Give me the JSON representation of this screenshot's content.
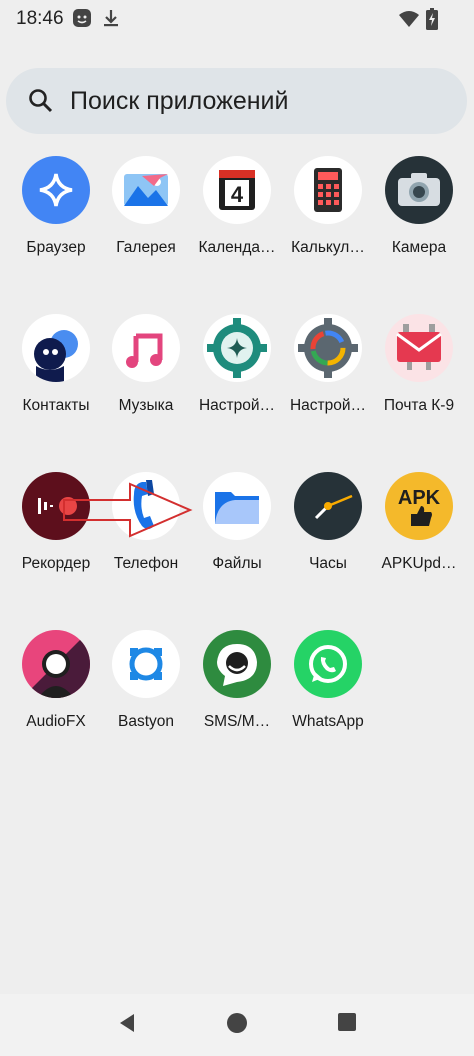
{
  "status_bar": {
    "time": "18:46",
    "icons": [
      "notification-face-icon",
      "download-icon",
      "wifi-icon",
      "battery-charging-icon"
    ]
  },
  "search": {
    "placeholder": "Поиск приложений",
    "icon": "search-icon"
  },
  "apps": [
    {
      "label": "Браузер",
      "icon": "browser-icon"
    },
    {
      "label": "Галерея",
      "icon": "gallery-icon"
    },
    {
      "label": "Календа…",
      "icon": "calendar-icon",
      "icon_text": "4"
    },
    {
      "label": "Калькул…",
      "icon": "calculator-icon"
    },
    {
      "label": "Камера",
      "icon": "camera-icon"
    },
    {
      "label": "Контакты",
      "icon": "contacts-icon"
    },
    {
      "label": "Музыка",
      "icon": "music-icon"
    },
    {
      "label": "Настрой…",
      "icon": "settings-icon"
    },
    {
      "label": "Настрой…",
      "icon": "settings-colorful-icon"
    },
    {
      "label": "Почта К-9",
      "icon": "k9-mail-icon"
    },
    {
      "label": "Рекордер",
      "icon": "recorder-icon"
    },
    {
      "label": "Телефон",
      "icon": "phone-icon"
    },
    {
      "label": "Файлы",
      "icon": "files-icon"
    },
    {
      "label": "Часы",
      "icon": "clock-icon"
    },
    {
      "label": "APKUpd…",
      "icon": "apk-updater-icon",
      "icon_text": "APK"
    },
    {
      "label": "AudioFX",
      "icon": "audiofx-icon"
    },
    {
      "label": "Bastyon",
      "icon": "bastyon-icon"
    },
    {
      "label": "SMS/M…",
      "icon": "sms-icon"
    },
    {
      "label": "WhatsApp",
      "icon": "whatsapp-icon"
    }
  ],
  "nav": {
    "back": "back-icon",
    "home": "home-icon",
    "recents": "recents-icon"
  },
  "colors": {
    "background": "#eeeeee",
    "search_bg": "#dfe4e8",
    "arrow_red": "#d32f2f"
  }
}
